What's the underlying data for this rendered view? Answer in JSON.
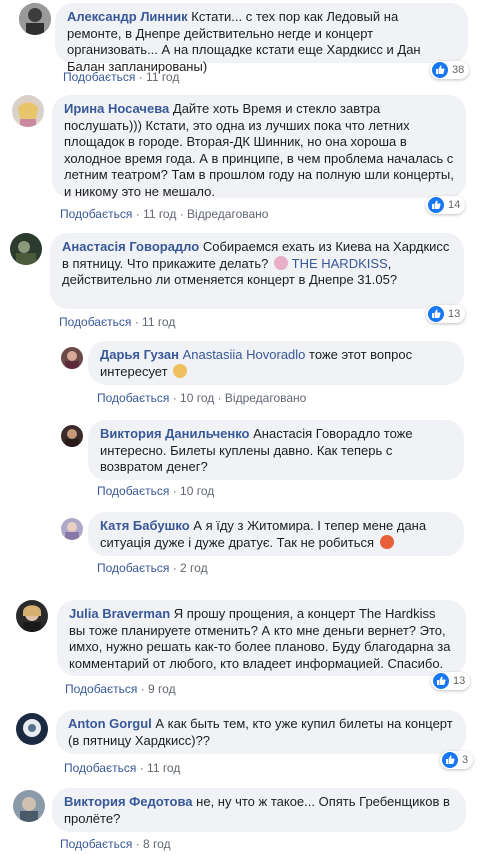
{
  "comments": [
    {
      "author": "Александр Линник",
      "text": "Кстати... с тех пор как Ледовый на ремонте, в Днепре действительно негде и концерт организовать... А на площадке кстати еще Хардкисс и Дан Балан запланированы)",
      "like": "Подобається",
      "time": "11 год",
      "reactions": "38"
    },
    {
      "author": "Ирина Носачева",
      "text": "Дайте хоть Время и стекло завтра послушать))) Кстати, это одна из лучших пока что летних площадок в городе. Вторая-ДК Шинник, но она хороша в холодное время года. А в принципе, в чем проблема началась с летним театром? Там в прошлом году на полную шли концерты, и никому это не мешало.",
      "like": "Подобається",
      "time": "11 год",
      "edited": "Відредаговано",
      "reactions": "14"
    },
    {
      "author": "Анастасія Говорадло",
      "text": "Собираемся ехать из Киева на Хардкисс в пятницу. Что прикажите делать?",
      "mention": "THE HARDKISS",
      "text2": ", действительно ли отменяется концерт в Днепре 31.05?",
      "like": "Подобається",
      "time": "11 год",
      "reactions": "13"
    },
    {
      "author": "Дарья Гузан",
      "mention": "Anastasiia Hovoradlo",
      "text": "тоже этот вопрос интересует",
      "like": "Подобається",
      "time": "10 год",
      "edited": "Відредаговано"
    },
    {
      "author": "Виктория Данильченко",
      "text": "Анастасія Говорадло тоже интересно. Билеты куплены давно. Как теперь с возвратом денег?",
      "like": "Подобається",
      "time": "10 год"
    },
    {
      "author": "Катя Бабушко",
      "text": "А я їду з Житомира. І тепер мене дана ситуація дуже і дуже дратує. Так не робиться",
      "like": "Подобається",
      "time": "2 год"
    },
    {
      "author": "Julia Braverman",
      "text": "Я прошу прощения, а концерт The Hardkiss вы тоже планируете отменить? А кто мне деньги вернет? Это, имхо, нужно решать как-то более планово. Буду благодарна за комментарий от любого, кто владеет информацией. Спасибо.",
      "like": "Подобається",
      "time": "9 год",
      "reactions": "13"
    },
    {
      "author": "Anton Gorgul",
      "text": "А как быть тем, кто уже купил билеты на концерт (в пятницу Хардкисс)??",
      "like": "Подобається",
      "time": "11 год",
      "reactions": "3"
    },
    {
      "author": "Виктория Федотова",
      "text": "не, ну что ж такое... Опять Гребенщиков в пролёте?",
      "like": "Подобається",
      "time": "8 год"
    }
  ],
  "colors": {
    "link": "#385898",
    "bubble": "#f0f2f5",
    "like_blue": "#1877f2"
  }
}
